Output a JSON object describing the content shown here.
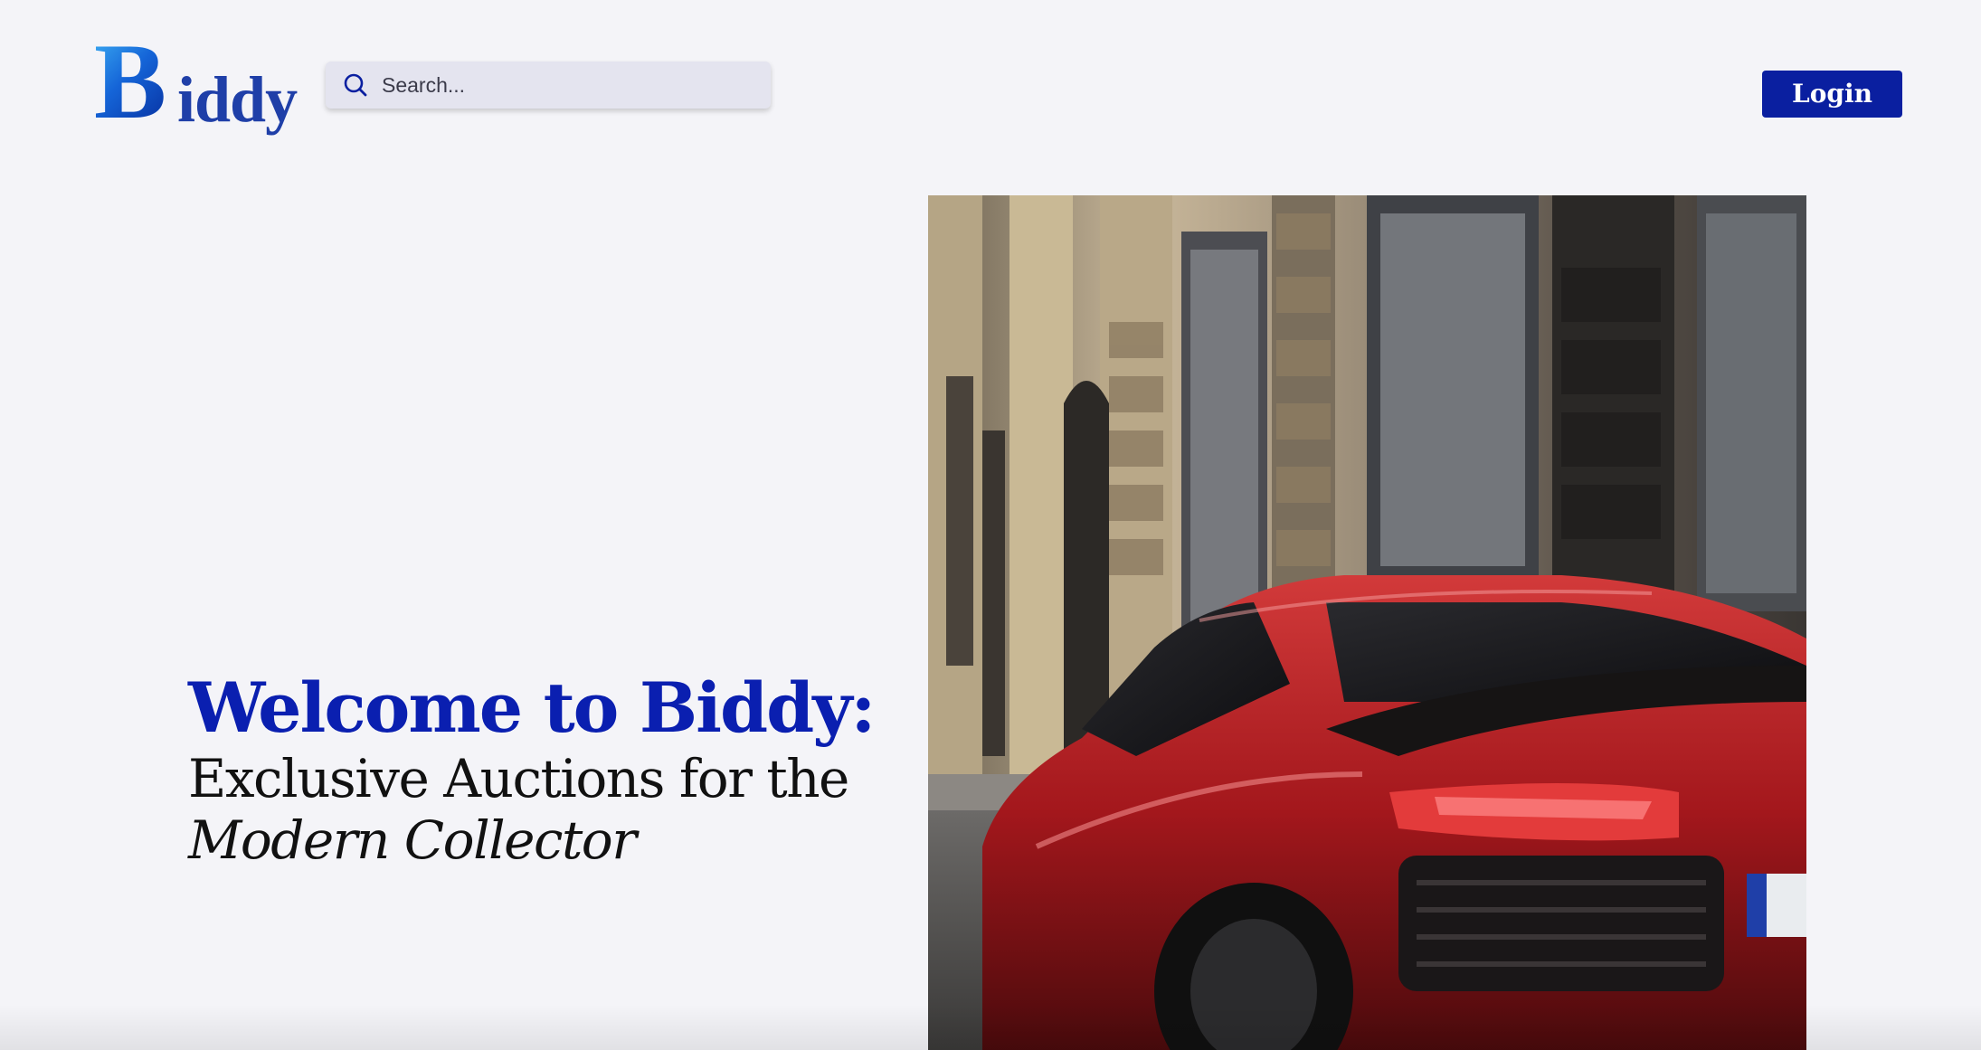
{
  "header": {
    "logo": {
      "first_letter": "B",
      "rest": "iddy",
      "colors": {
        "primary": "#1565d8",
        "accent": "#53c4ff",
        "text": "#1f3fa8"
      }
    },
    "search": {
      "placeholder": "Search...",
      "value": "",
      "icon": "search-icon"
    },
    "login_label": "Login"
  },
  "hero": {
    "title": "Welcome to Biddy:",
    "subtitle_line1": "Exclusive Auctions for the",
    "subtitle_line2": "Modern Collector",
    "image": "red-sports-car-on-city-street"
  },
  "colors": {
    "brand": "#0a1fa0",
    "title": "#0a1fb0",
    "background": "#f4f4f8",
    "search_bg": "#e4e4ef"
  }
}
